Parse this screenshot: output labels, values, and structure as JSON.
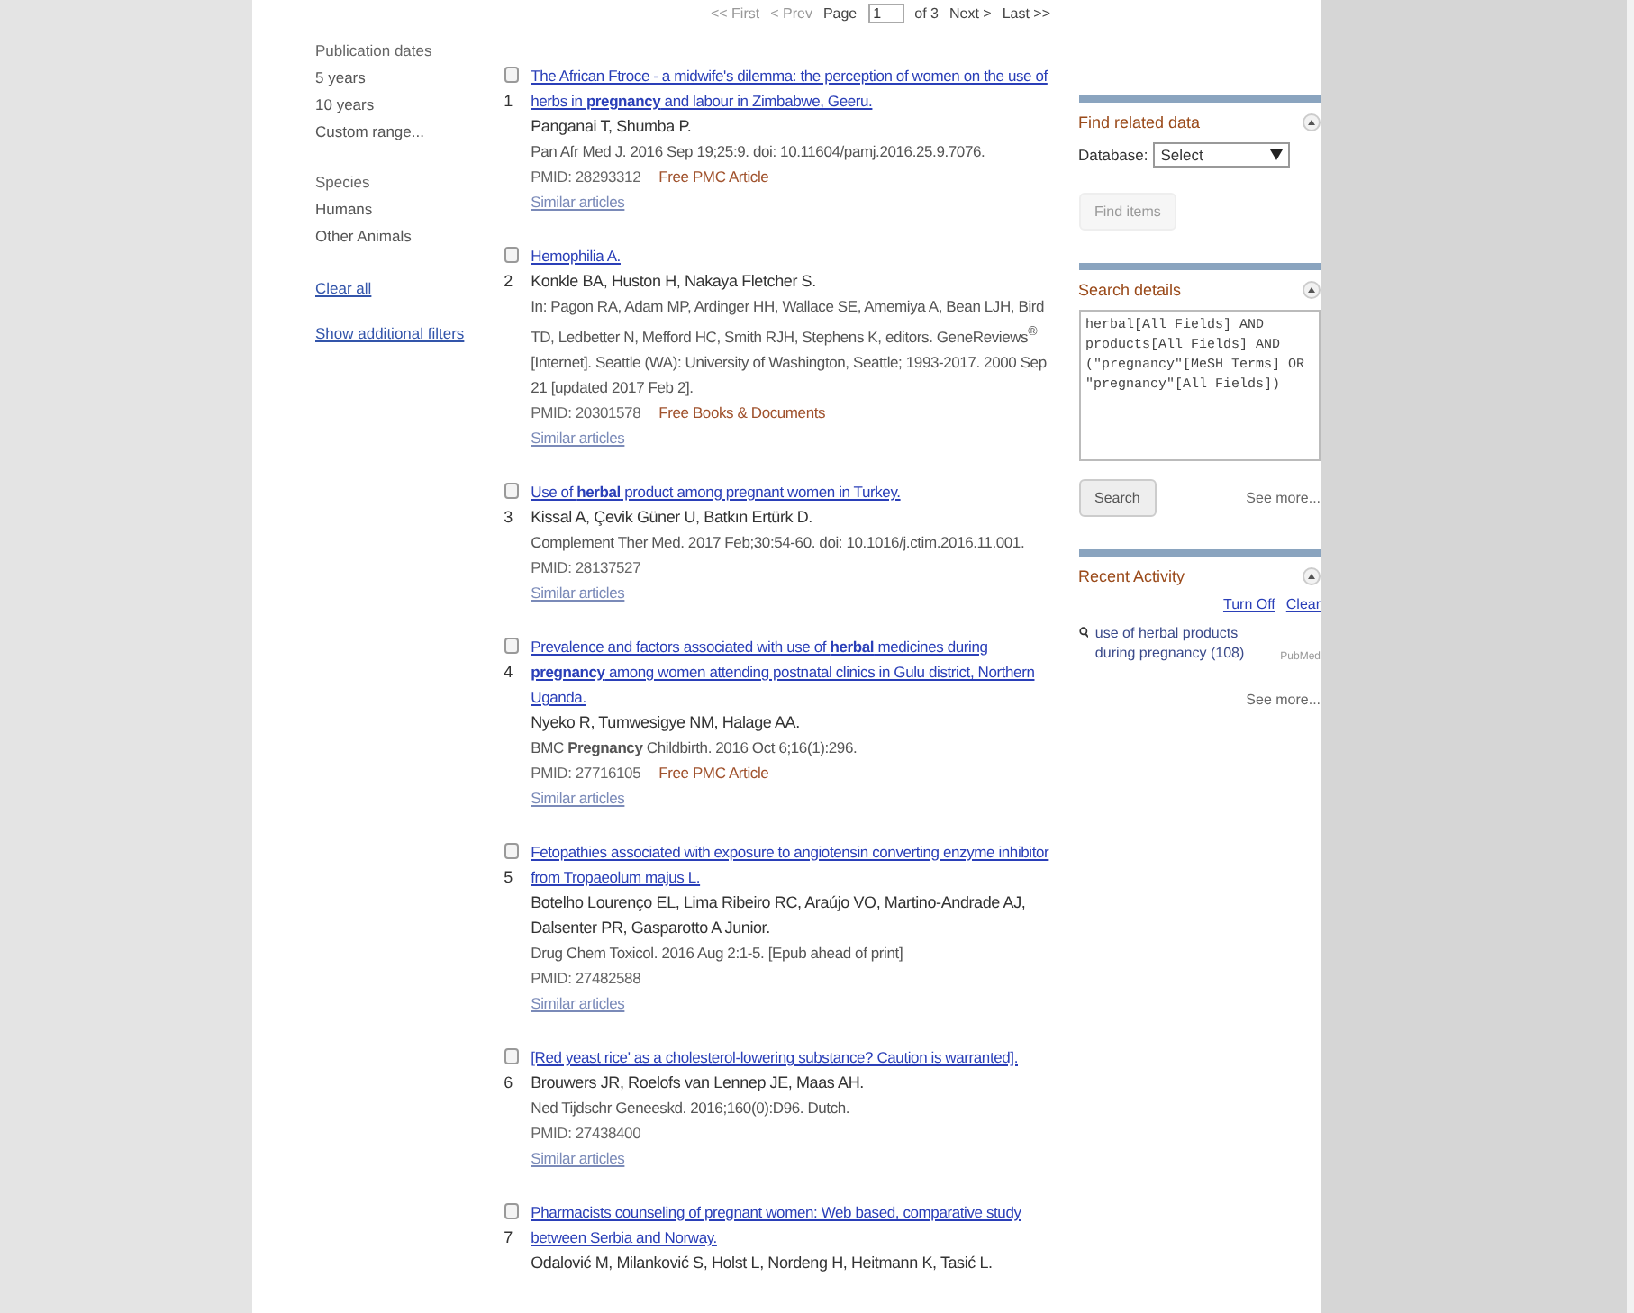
{
  "pagination": {
    "first": "<< First",
    "prev": "< Prev",
    "page_label": "Page",
    "page": "1",
    "of": "of 3",
    "next": "Next >",
    "last": "Last >>"
  },
  "filters": {
    "groups": [
      {
        "title": "Publication dates",
        "items": [
          "5 years",
          "10 years",
          "Custom range..."
        ]
      },
      {
        "title": "Species",
        "items": [
          "Humans",
          "Other Animals"
        ]
      }
    ],
    "clear_all": "Clear all",
    "show_additional": "Show additional filters"
  },
  "results": [
    {
      "number": "1",
      "checked": false,
      "title": "The African Ftroce - a midwife's dilemma: the perception of women on the use of herbs in **pregnancy** and labour in Zimbabwe, Geeru.",
      "authors": "Panganai T, Shumba P.",
      "citation": "Pan Afr Med J. 2016 Sep 19;25:9. doi: 10.11604/pamj.2016.25.9.7076.",
      "pmid": "PMID: 28293312",
      "tag": "Free PMC Article",
      "similar": "Similar articles"
    },
    {
      "number": "2",
      "checked": false,
      "title": "Hemophilia A.",
      "authors": "Konkle BA, Huston H, Nakaya Fletcher S.",
      "citation": "In: Pagon RA, Adam MP, Ardinger HH, Wallace SE, Amemiya A, Bean LJH, Bird TD, Ledbetter N, Mefford HC, Smith RJH, Stephens K, editors. GeneReviews$^{®}$ [Internet]. Seattle (WA): University of Washington, Seattle; 1993-2017. 2000 Sep 21 [updated 2017 Feb 2].",
      "pmid": "PMID: 20301578",
      "tag": "Free Books & Documents",
      "similar": "Similar articles"
    },
    {
      "number": "3",
      "checked": false,
      "title": "Use of **herbal** product among pregnant women in Turkey.",
      "authors": "Kissal A, Çevik Güner U, Batkın Ertürk D.",
      "citation": "Complement Ther Med. 2017 Feb;30:54-60. doi: 10.1016/j.ctim.2016.11.001.",
      "pmid": "PMID: 28137527",
      "similar": "Similar articles"
    },
    {
      "number": "4",
      "checked": false,
      "title": "Prevalence and factors associated with use of **herbal** medicines during **pregnancy** among women attending postnatal clinics in Gulu district, Northern Uganda.",
      "authors": "Nyeko R, Tumwesigye NM, Halage AA.",
      "citation": "BMC **Pregnancy** Childbirth. 2016 Oct 6;16(1):296.",
      "pmid": "PMID: 27716105",
      "tag": "Free PMC Article",
      "similar": "Similar articles"
    },
    {
      "number": "5",
      "checked": false,
      "title": "Fetopathies associated with exposure to angiotensin converting enzyme inhibitor from Tropaeolum majus L.",
      "authors": "Botelho Lourenço EL, Lima Ribeiro RC, Araújo VO, Martino-Andrade AJ, Dalsenter PR, Gasparotto A Junior.",
      "citation": "Drug Chem Toxicol. 2016 Aug 2:1-5. [Epub ahead of print]",
      "pmid": "PMID: 27482588",
      "similar": "Similar articles"
    },
    {
      "number": "6",
      "checked": false,
      "title": "[Red yeast rice' as a cholesterol-lowering substance? Caution is warranted].",
      "authors": "Brouwers JR, Roelofs van Lennep JE, Maas AH.",
      "citation": "Ned Tijdschr Geneeskd. 2016;160(0):D96. Dutch.",
      "pmid": "PMID: 27438400",
      "similar": "Similar articles"
    },
    {
      "number": "7",
      "checked": false,
      "title": "Pharmacists counseling of pregnant women: Web based, comparative study between Serbia and Norway.",
      "authors": "Odalović M, Milanković S, Holst L, Nordeng H, Heitmann K, Tasić L."
    }
  ],
  "find_related": {
    "title": "Find related data",
    "database_label": "Database:",
    "database_value": "Select",
    "button": "Find items",
    "button_disabled": true
  },
  "search_details": {
    "title": "Search details",
    "query": "herbal[All Fields] AND products[All Fields] AND (\"pregnancy\"[MeSH Terms] OR \"pregnancy\"[All Fields])",
    "button": "Search",
    "see_more": "See more..."
  },
  "recent_activity": {
    "title": "Recent Activity",
    "turn_off": "Turn Off",
    "clear": "Clear",
    "items": [
      {
        "text": "use of herbal products during pregnancy (108)",
        "source": "PubMed"
      }
    ],
    "see_more": "See more..."
  }
}
